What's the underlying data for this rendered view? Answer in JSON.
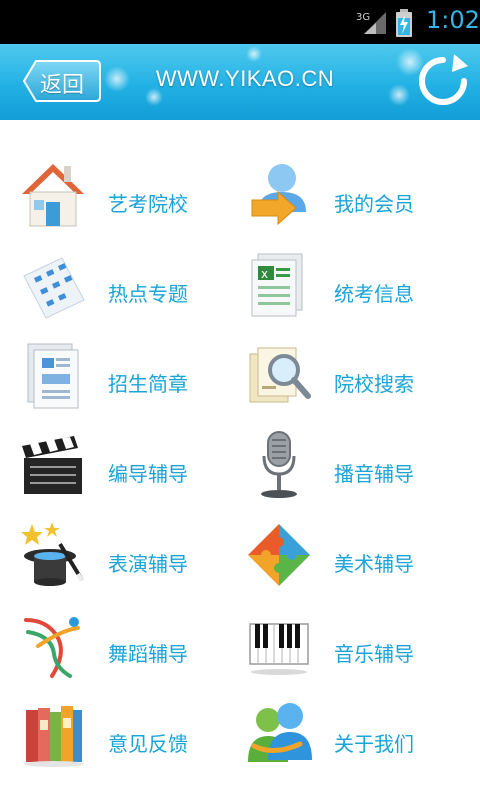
{
  "status_bar": {
    "network": "3G",
    "time": "1:02",
    "icons": [
      "signal-icon",
      "battery-charging-icon"
    ]
  },
  "header": {
    "back_label": "返回",
    "title": "WWW.YIKAO.CN",
    "refresh_icon": "refresh-icon",
    "colors": {
      "bar_top": "#4fc9ee",
      "bar_bottom": "#129dd6"
    }
  },
  "menu": {
    "label_color": "#1aa4d8",
    "items": [
      {
        "label": "艺考院校",
        "icon": "house-icon"
      },
      {
        "label": "我的会员",
        "icon": "member-user-icon"
      },
      {
        "label": "热点专题",
        "icon": "hot-topics-icon"
      },
      {
        "label": "统考信息",
        "icon": "spreadsheet-icon"
      },
      {
        "label": "招生简章",
        "icon": "brochure-icon"
      },
      {
        "label": "院校搜索",
        "icon": "magnifier-search-icon"
      },
      {
        "label": "编导辅导",
        "icon": "clapperboard-icon"
      },
      {
        "label": "播音辅导",
        "icon": "microphone-icon"
      },
      {
        "label": "表演辅导",
        "icon": "magic-hat-icon"
      },
      {
        "label": "美术辅导",
        "icon": "puzzle-icon"
      },
      {
        "label": "舞蹈辅导",
        "icon": "dancer-icon"
      },
      {
        "label": "音乐辅导",
        "icon": "piano-keys-icon"
      },
      {
        "label": "意见反馈",
        "icon": "books-icon"
      },
      {
        "label": "关于我们",
        "icon": "people-icon"
      }
    ]
  }
}
